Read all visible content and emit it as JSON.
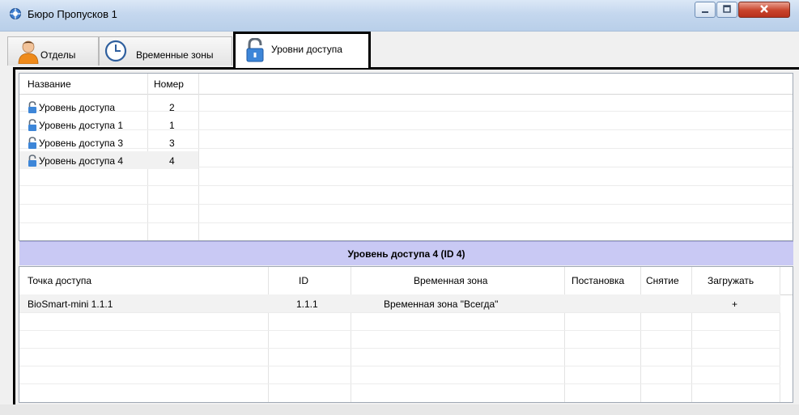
{
  "window": {
    "title": "Бюро Пропусков 1"
  },
  "tabs": [
    {
      "label": "Отделы",
      "icon": "person-icon"
    },
    {
      "label": "Временные зоны",
      "icon": "clock-icon"
    },
    {
      "label": "Уровни доступа",
      "icon": "padlock-icon",
      "active": true
    }
  ],
  "levels_table": {
    "columns": [
      "Название",
      "Номер"
    ],
    "rows": [
      {
        "name": "Уровень доступа",
        "number": "2"
      },
      {
        "name": "Уровень доступа 1",
        "number": "1"
      },
      {
        "name": "Уровень доступа 3",
        "number": "3"
      },
      {
        "name": "Уровень доступа 4",
        "number": "4",
        "selected": true
      }
    ]
  },
  "details": {
    "caption": "Уровень доступа 4 (ID 4)",
    "columns": [
      "Точка доступа",
      "ID",
      "Временная зона",
      "Постановка",
      "Снятие",
      "Загружать"
    ],
    "rows": [
      {
        "point": "BioSmart-mini 1.1.1",
        "id": "1.1.1",
        "zone": "Временная зона \"Всегда\"",
        "arm": "",
        "disarm": "",
        "load": "+"
      }
    ]
  },
  "colors": {
    "caption_bg": "#c9c9f4",
    "titlebar": "#c4d7ee",
    "close_button": "#c8432b"
  }
}
